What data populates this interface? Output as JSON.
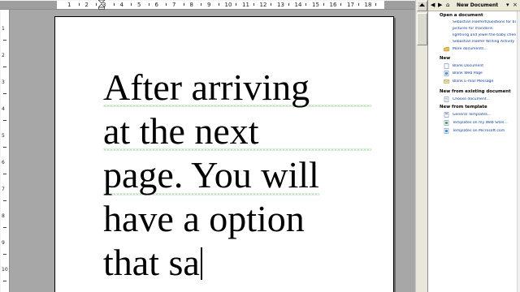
{
  "ruler": {
    "h_numbers": [
      "1",
      "2",
      "3",
      "4",
      "5",
      "6",
      "7",
      "8",
      "9",
      "10",
      "11",
      "12",
      "13",
      "14",
      "15",
      "16",
      "17",
      "18"
    ],
    "v_numbers": [
      "1",
      "2",
      "3",
      "4",
      "5",
      "6",
      "7",
      "8",
      "9",
      "10"
    ]
  },
  "document": {
    "lines": [
      "After arriving",
      "at the next",
      "page. You will",
      "have a option",
      "that sa"
    ]
  },
  "scrollbar": {
    "up_icon": "triangle-up",
    "down_icon": "triangle-down"
  },
  "task_pane": {
    "back_glyph": "◀",
    "forward_glyph": "▶",
    "home_glyph": "⌂",
    "title": "New Document",
    "dropdown_glyph": "▾",
    "close_glyph": "×",
    "sections": {
      "open": {
        "title": "Open a document",
        "items": [
          "Sebastian HoefertQuestions for bl",
          "pictures for mandarin",
          "lightning and jewel the baby chee",
          "Sebastian Hoefer Writing Activity"
        ],
        "more": "More documents..."
      },
      "new": {
        "title": "New",
        "items": [
          "Blank Document",
          "Blank Web Page",
          "Blank E-mail Message"
        ]
      },
      "existing": {
        "title": "New from existing document",
        "items": [
          "Choose document..."
        ]
      },
      "template": {
        "title": "New from template",
        "items": [
          "General Templates...",
          "Templates on my Web Sites...",
          "Templates on Microsoft.com"
        ]
      }
    }
  },
  "colors": {
    "page_background": "#a7a7a7",
    "link": "#0b3a9e",
    "grammar_squiggle": "#6cbf6c"
  }
}
